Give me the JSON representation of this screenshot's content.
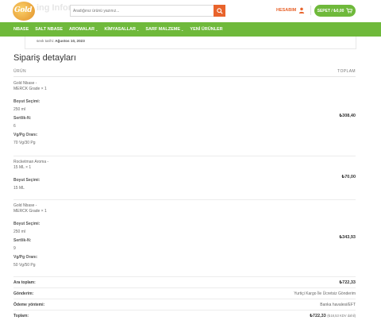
{
  "header": {
    "logo_text": "Gold",
    "ghost_title": "ing Inform",
    "search_placeholder": "Aradığınız ürünü yazınız...",
    "account_label": "HESABIM",
    "cart_label": "SEPET / ₺0,00"
  },
  "nav": {
    "items": [
      {
        "label": "NBASE",
        "has_dropdown": false
      },
      {
        "label": "SALT NBASE",
        "has_dropdown": false
      },
      {
        "label": "AROMALAR",
        "has_dropdown": true
      },
      {
        "label": "KİMYASALLAR",
        "has_dropdown": true
      },
      {
        "label": "SARF MALZEME",
        "has_dropdown": true
      },
      {
        "label": "YENİ ÜRÜNLER",
        "has_dropdown": false
      }
    ],
    "chevron": "⌄"
  },
  "notice": {
    "prefix": "sevk tarihi: ",
    "date": "Ağustos 10, 2023"
  },
  "order": {
    "title": "Sipariş detayları",
    "col_product": "ÜRÜN",
    "col_total": "TOPLAM",
    "items": [
      {
        "name_line1": "Gold Nbase -",
        "name_line2": "MERCK Grade × 1",
        "meta": [
          {
            "key": "Boyut Seçimi:",
            "value": "250 ml"
          },
          {
            "key": "Sertlik-N:",
            "value": "6"
          },
          {
            "key": "Vg/Pg Oranı:",
            "value": "70 Vg/30 Pg"
          }
        ],
        "price": "₺308,40"
      },
      {
        "name_line1": "Rocketman Aroma -",
        "name_line2": "15 ML × 1",
        "meta": [
          {
            "key": "Boyut Seçimi:",
            "value": "15 ML"
          }
        ],
        "price": "₺70,00"
      },
      {
        "name_line1": "Gold Nbase -",
        "name_line2": "MERCK Grade × 1",
        "meta": [
          {
            "key": "Boyut Seçimi:",
            "value": "250 ml"
          },
          {
            "key": "Sertlik-N:",
            "value": "9"
          },
          {
            "key": "Vg/Pg Oranı:",
            "value": "50 Vg/50 Pg"
          }
        ],
        "price": "₺343,93"
      }
    ],
    "totals": {
      "subtotal_label": "Ara toplam:",
      "subtotal_value": "₺722,33",
      "shipping_label": "Gönderim:",
      "shipping_value": "Yurtiçi Kargo İle Ücretsiz Gönderim",
      "payment_label": "Ödeme yöntemi:",
      "payment_value": "Banka havalesi/EFT",
      "total_label": "Toplam:",
      "total_value": "₺722,33",
      "total_tax_note": "(₺18,53 KDV dahil)"
    }
  },
  "colors": {
    "accent_orange": "#e8632b",
    "brand_green": "#6fb93b"
  }
}
